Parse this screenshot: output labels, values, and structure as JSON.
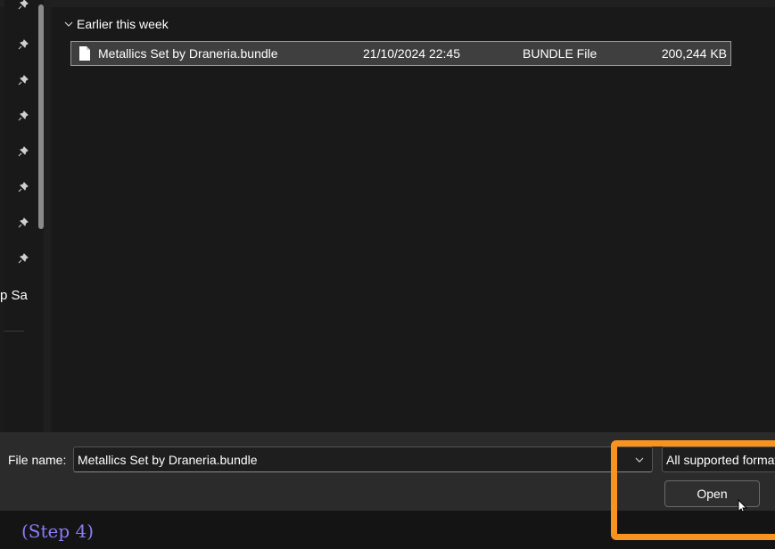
{
  "sidebar": {
    "partial_label": "p Sa ",
    "pin_icons": [
      "pin-icon",
      "pin-icon",
      "pin-icon",
      "pin-icon",
      "pin-icon",
      "pin-icon",
      "pin-icon",
      "pin-icon"
    ]
  },
  "file_list": {
    "group_header": "Earlier this week",
    "files": [
      {
        "name": "Metallics Set by Draneria.bundle",
        "date_modified": "21/10/2024 22:45",
        "type": "BUNDLE File",
        "size": "200,244 KB"
      }
    ]
  },
  "bottom_bar": {
    "file_name_label": "File name:",
    "file_name_value": "Metallics Set by Draneria.bundle",
    "file_type_filter": "All supported formats",
    "open_button_label": "Open"
  },
  "annotation": {
    "step_label": "(Step 4)",
    "highlight_color": "#f7931e",
    "step_label_color": "#8a7cf5"
  }
}
